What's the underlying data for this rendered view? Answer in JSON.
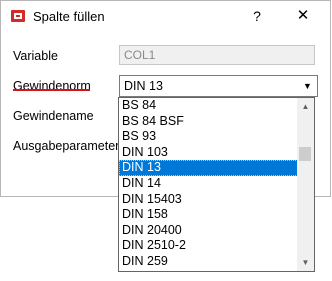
{
  "window": {
    "title": "Spalte füllen",
    "help_glyph": "?",
    "close_glyph": "✕"
  },
  "form": {
    "variable_label": "Variable",
    "variable_value": "COL1",
    "gewindenorm_label": "Gewindenorm",
    "gewindenorm_value": "DIN 13",
    "gewindename_label": "Gewindename",
    "ausgabeparameter_label": "Ausgabeparameter"
  },
  "dropdown": {
    "items": [
      "BS 84",
      "BS 84 BSF",
      "BS 93",
      "DIN 103",
      "DIN 13",
      "DIN 14",
      "DIN 15403",
      "DIN 158",
      "DIN 20400",
      "DIN 2510-2",
      "DIN 259"
    ],
    "selected": "DIN 13"
  },
  "colors": {
    "accent_underline": "#d4141b",
    "selection": "#0078d7"
  },
  "icons": {
    "app": "app-icon",
    "combo_arrow": "chevron-down-icon",
    "scroll_up": "scroll-up-arrow-icon",
    "scroll_down": "scroll-down-arrow-icon"
  }
}
